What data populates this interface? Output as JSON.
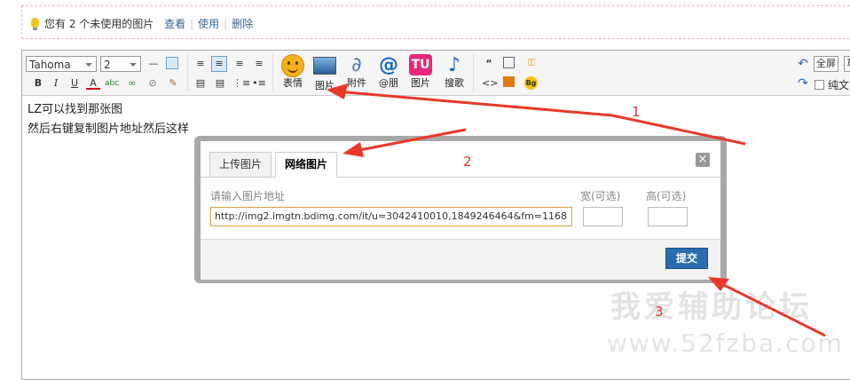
{
  "notice": {
    "text": "您有 2 个未使用的图片",
    "view": "查看",
    "use": "使用",
    "delete": "删除"
  },
  "toolbar": {
    "font_family": "Tahoma",
    "font_size": "2",
    "emoji_label": "表情",
    "image_label": "图片",
    "attach_label": "附件",
    "at_label": "@朋",
    "tu_label": "图片",
    "music_label": "搜歌",
    "fullscreen_label": "全屏",
    "plaintext_label": "纯文",
    "draft_label": "草",
    "icons": [
      "bold-icon",
      "italic-icon",
      "underline-icon",
      "font-color-icon",
      "spellcheck-icon",
      "link-icon",
      "unlink-icon",
      "clear-format-icon",
      "align-left-icon",
      "align-center-icon",
      "align-right-icon",
      "list-ordered-icon",
      "list-unordered-icon",
      "quote-icon",
      "code-icon",
      "hide-icon",
      "bg-icon"
    ]
  },
  "content": {
    "line1": "LZ可以找到那张图",
    "line2": "然后右键复制图片地址然后这样"
  },
  "dialog": {
    "tab_upload": "上传图片",
    "tab_network": "网络图片",
    "close": "×",
    "url_label": "请输入图片地址",
    "url_value": "http://img2.imgtn.bdimg.com/it/u=3042410010,1849246464&fm=1168",
    "width_label": "宽(可选)",
    "height_label": "高(可选)",
    "width_value": "",
    "height_value": "",
    "submit_label": "提交"
  },
  "annotations": {
    "n1": "1",
    "n2": "2",
    "n3": "3",
    "arrow_color": "#e8392a"
  },
  "watermark": {
    "title": "我爱辅助论坛",
    "url": "www.52fzba.com"
  }
}
